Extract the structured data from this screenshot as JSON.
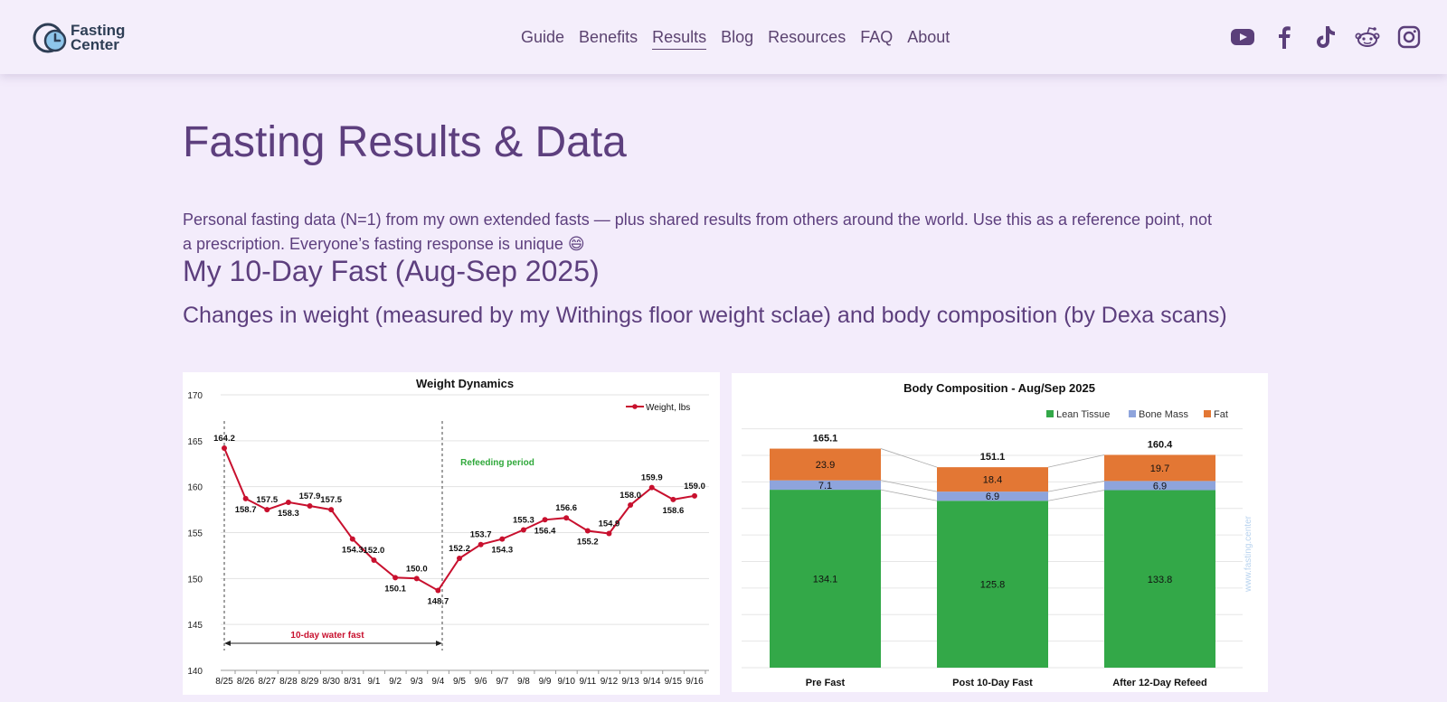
{
  "header": {
    "logo": {
      "line1": "Fasting",
      "line2": "Center"
    },
    "nav": [
      {
        "label": "Guide",
        "active": false
      },
      {
        "label": "Benefits",
        "active": false
      },
      {
        "label": "Results",
        "active": true
      },
      {
        "label": "Blog",
        "active": false
      },
      {
        "label": "Resources",
        "active": false
      },
      {
        "label": "FAQ",
        "active": false
      },
      {
        "label": "About",
        "active": false
      }
    ],
    "social_icons": [
      "youtube-icon",
      "facebook-icon",
      "tiktok-icon",
      "reddit-icon",
      "instagram-icon"
    ]
  },
  "main": {
    "title": "Fasting Results & Data",
    "intro": "Personal fasting data (N=1) from my own extended fasts — plus shared results from others around the world. Use this as a reference point, not a prescription. Everyone’s fasting response is unique 😄",
    "section_title": "My 10-Day Fast (Aug-Sep 2025)",
    "section_subtitle": "Changes in weight (measured by my Withings floor weight sclae) and body composition (by Dexa scans)"
  },
  "colors": {
    "weight_line": "#c8102e",
    "lean": "#33a848",
    "bone": "#8ea4dc",
    "fat": "#e37734",
    "refeed_label": "#2fa83a",
    "fast_label": "#c8102e"
  },
  "chart_data": [
    {
      "type": "line",
      "title": "Weight Dynamics",
      "categories": [
        "8/25",
        "8/26",
        "8/27",
        "8/28",
        "8/29",
        "8/30",
        "8/31",
        "9/1",
        "9/2",
        "9/3",
        "9/4",
        "9/5",
        "9/6",
        "9/7",
        "9/8",
        "9/9",
        "9/10",
        "9/11",
        "9/12",
        "9/13",
        "9/14",
        "9/15",
        "9/16"
      ],
      "series": [
        {
          "name": "Weight, lbs",
          "values": [
            164.2,
            158.7,
            157.5,
            158.3,
            157.9,
            157.5,
            154.3,
            152.0,
            150.1,
            150.0,
            148.7,
            152.2,
            153.7,
            154.3,
            155.3,
            156.4,
            156.6,
            155.2,
            154.9,
            158.0,
            159.9,
            158.6,
            159.0
          ]
        }
      ],
      "ylim": [
        140,
        170
      ],
      "yticks": [
        140,
        145,
        150,
        155,
        160,
        165,
        170
      ],
      "grid": true,
      "legend": "top-right",
      "annotations": [
        {
          "text": "10-day water fast"
        },
        {
          "text": "Refeeding period"
        }
      ]
    },
    {
      "type": "bar",
      "stacked": true,
      "title": "Body Composition - Aug/Sep 2025",
      "categories": [
        "Pre Fast",
        "Post 10-Day Fast",
        "After 12-Day Refeed"
      ],
      "series": [
        {
          "name": "Lean Tissue",
          "values": [
            134.1,
            125.8,
            133.8
          ]
        },
        {
          "name": "Bone Mass",
          "values": [
            7.1,
            6.9,
            6.9
          ]
        },
        {
          "name": "Fat",
          "values": [
            23.9,
            18.4,
            19.7
          ]
        }
      ],
      "totals": [
        165.1,
        151.1,
        160.4
      ],
      "ylim": [
        0,
        190
      ],
      "legend": "top-right",
      "watermark": "www.fasting.center"
    }
  ]
}
